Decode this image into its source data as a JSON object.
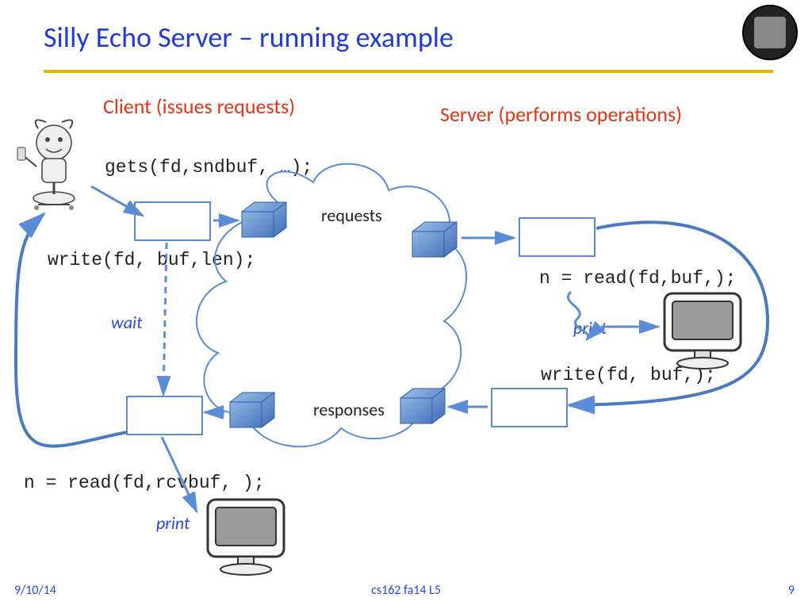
{
  "title": "Silly Echo Server – running example",
  "clientLabel": "Client (issues requests)",
  "serverLabel": "Server (performs operations)",
  "code": {
    "gets": "gets(fd,sndbuf, …);",
    "writeClient": "write(fd, buf,len);",
    "readServer": "n = read(fd,buf,);",
    "writeServer": "write(fd, buf,);",
    "readClient": "n = read(fd,rcvbuf, );"
  },
  "labels": {
    "wait": "wait",
    "print1": "print",
    "print2": "print",
    "requests": "requests",
    "responses": "responses"
  },
  "footer": {
    "date": "9/10/14",
    "center": "cs162 fa14 L5",
    "page": "9"
  }
}
